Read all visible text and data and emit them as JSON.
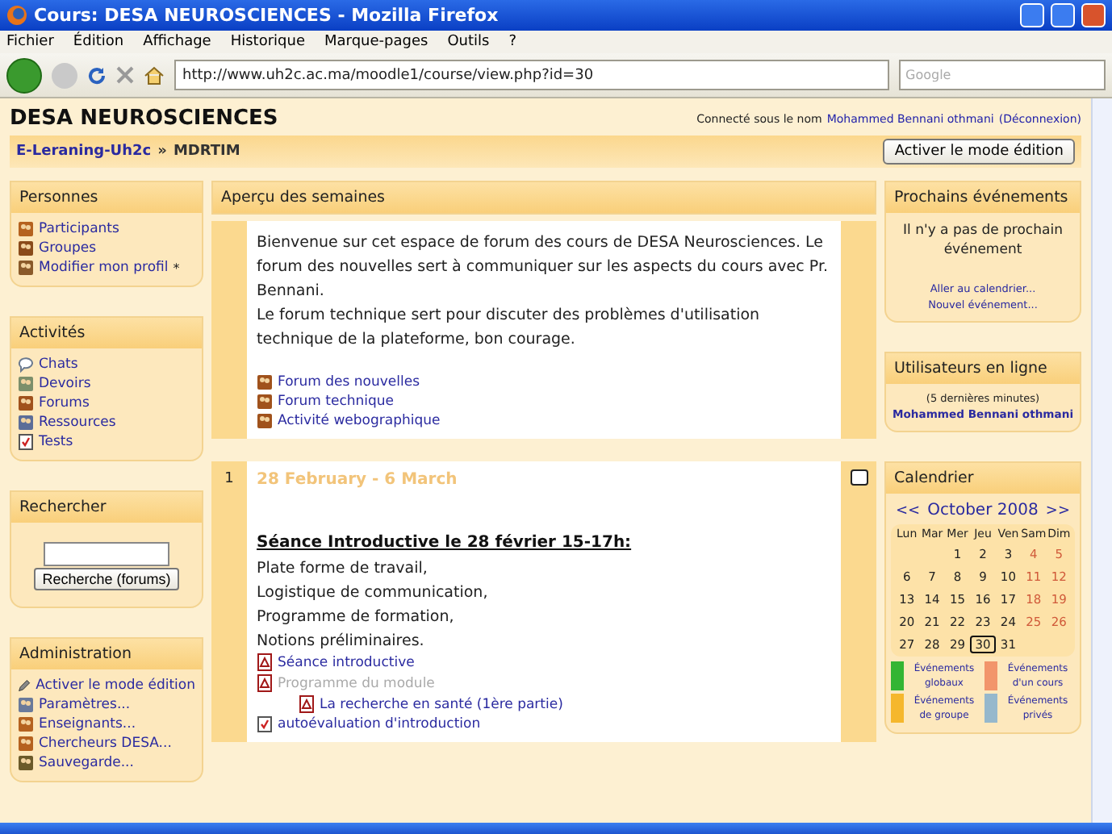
{
  "window": {
    "title": "Cours: DESA NEUROSCIENCES - Mozilla Firefox"
  },
  "menu": [
    "Fichier",
    "Édition",
    "Affichage",
    "Historique",
    "Marque-pages",
    "Outils",
    "?"
  ],
  "toolbar": {
    "url": "http://www.uh2c.ac.ma/moodle1/course/view.php?id=30",
    "search_placeholder": "Google"
  },
  "page": {
    "site_title": "DESA NEUROSCIENCES",
    "login_prefix": "Connecté sous le nom",
    "login_user": "Mohammed Bennani othmani",
    "logout": "(Déconnexion)",
    "breadcrumb": [
      "E-Leraning-Uh2c",
      "MDRTIM"
    ],
    "breadcrumb_separator": "»",
    "edit_button": "Activer le mode édition"
  },
  "left_blocks": [
    {
      "kind": "links",
      "title": "Personnes",
      "items": [
        {
          "label": "Participants",
          "kind": "people"
        },
        {
          "label": "Groupes",
          "kind": "group"
        },
        {
          "label": "Modifier mon profil",
          "kind": "profile",
          "suffix": "*"
        }
      ]
    },
    {
      "kind": "links",
      "title": "Activités",
      "items": [
        {
          "label": "Chats",
          "kind": "chat"
        },
        {
          "label": "Devoirs",
          "kind": "assignment"
        },
        {
          "label": "Forums",
          "kind": "forum"
        },
        {
          "label": "Ressources",
          "kind": "resource"
        },
        {
          "label": "Tests",
          "kind": "quiz"
        }
      ]
    },
    {
      "kind": "search",
      "title": "Rechercher",
      "button": "Recherche (forums)"
    },
    {
      "kind": "links",
      "title": "Administration",
      "items": [
        {
          "label": "Activer le mode édition",
          "kind": "edit"
        },
        {
          "label": "Paramètres...",
          "kind": "settings"
        },
        {
          "label": "Enseignants...",
          "kind": "people"
        },
        {
          "label": "Chercheurs DESA...",
          "kind": "people"
        },
        {
          "label": "Sauvegarde...",
          "kind": "backup"
        }
      ]
    }
  ],
  "center": {
    "title": "Aperçu des semaines",
    "intro": {
      "paragraphs": [
        "Bienvenue sur cet espace de forum des cours de DESA Neurosciences. Le forum des nouvelles sert à communiquer sur les aspects du cours avec Pr. Bennani.",
        "Le forum technique sert pour discuter des problèmes d'utilisation technique de la plateforme, bon courage."
      ],
      "links": [
        {
          "label": "Forum des nouvelles",
          "kind": "forum",
          "disabled": false
        },
        {
          "label": "Forum technique",
          "kind": "forum",
          "disabled": false
        },
        {
          "label": "Activité webographique",
          "kind": "forum",
          "disabled": false
        }
      ]
    },
    "weeks": [
      {
        "number": "1",
        "dates": "28 February - 6 March",
        "heading": "Séance Introductive le 28 février 15-17h:",
        "lines": [
          "Plate forme de travail,",
          "Logistique de communication,",
          "Programme de formation,",
          "Notions préliminaires."
        ],
        "links": [
          {
            "label": "Séance introductive",
            "kind": "pdf",
            "disabled": false
          },
          {
            "label": "Programme du module",
            "kind": "pdf",
            "disabled": true,
            "children": [
              {
                "label": "La recherche en santé (1ère partie)",
                "kind": "pdf",
                "disabled": false
              }
            ]
          },
          {
            "label": "autoévaluation d'introduction",
            "kind": "quiz",
            "disabled": false
          }
        ]
      }
    ]
  },
  "right_blocks": [
    {
      "kind": "events",
      "title": "Prochains événements",
      "message": "Il n'y a pas de prochain événement",
      "links": [
        "Aller au calendrier...",
        "Nouvel événement..."
      ]
    },
    {
      "kind": "online",
      "title": "Utilisateurs en ligne",
      "note": "(5 dernières minutes)",
      "users": [
        "Mohammed Bennani othmani"
      ]
    },
    {
      "kind": "calendar",
      "title": "Calendrier",
      "prev": "<<",
      "month": "October 2008",
      "next": ">>",
      "weekdays": [
        "Lun",
        "Mar",
        "Mer",
        "Jeu",
        "Ven",
        "Sam",
        "Dim"
      ],
      "weeks": [
        [
          {
            "kind": "blank"
          },
          {
            "kind": "blank"
          },
          {
            "kind": "day",
            "day": "1",
            "weekend": false,
            "today": false
          },
          {
            "kind": "day",
            "day": "2",
            "weekend": false,
            "today": false
          },
          {
            "kind": "day",
            "day": "3",
            "weekend": false,
            "today": false
          },
          {
            "kind": "day",
            "day": "4",
            "weekend": true,
            "today": false
          },
          {
            "kind": "day",
            "day": "5",
            "weekend": true,
            "today": false
          }
        ],
        [
          {
            "kind": "day",
            "day": "6",
            "weekend": false,
            "today": false
          },
          {
            "kind": "day",
            "day": "7",
            "weekend": false,
            "today": false
          },
          {
            "kind": "day",
            "day": "8",
            "weekend": false,
            "today": false
          },
          {
            "kind": "day",
            "day": "9",
            "weekend": false,
            "today": false
          },
          {
            "kind": "day",
            "day": "10",
            "weekend": false,
            "today": false
          },
          {
            "kind": "day",
            "day": "11",
            "weekend": true,
            "today": false
          },
          {
            "kind": "day",
            "day": "12",
            "weekend": true,
            "today": false
          }
        ],
        [
          {
            "kind": "day",
            "day": "13",
            "weekend": false,
            "today": false
          },
          {
            "kind": "day",
            "day": "14",
            "weekend": false,
            "today": false
          },
          {
            "kind": "day",
            "day": "15",
            "weekend": false,
            "today": false
          },
          {
            "kind": "day",
            "day": "16",
            "weekend": false,
            "today": false
          },
          {
            "kind": "day",
            "day": "17",
            "weekend": false,
            "today": false
          },
          {
            "kind": "day",
            "day": "18",
            "weekend": true,
            "today": false
          },
          {
            "kind": "day",
            "day": "19",
            "weekend": true,
            "today": false
          }
        ],
        [
          {
            "kind": "day",
            "day": "20",
            "weekend": false,
            "today": false
          },
          {
            "kind": "day",
            "day": "21",
            "weekend": false,
            "today": false
          },
          {
            "kind": "day",
            "day": "22",
            "weekend": false,
            "today": false
          },
          {
            "kind": "day",
            "day": "23",
            "weekend": false,
            "today": false
          },
          {
            "kind": "day",
            "day": "24",
            "weekend": false,
            "today": false
          },
          {
            "kind": "day",
            "day": "25",
            "weekend": true,
            "today": false
          },
          {
            "kind": "day",
            "day": "26",
            "weekend": true,
            "today": false
          }
        ],
        [
          {
            "kind": "day",
            "day": "27",
            "weekend": false,
            "today": false
          },
          {
            "kind": "day",
            "day": "28",
            "weekend": false,
            "today": false
          },
          {
            "kind": "day",
            "day": "29",
            "weekend": false,
            "today": false
          },
          {
            "kind": "day",
            "day": "30",
            "weekend": false,
            "today": true
          },
          {
            "kind": "day",
            "day": "31",
            "weekend": false,
            "today": false
          },
          {
            "kind": "blank"
          },
          {
            "kind": "blank"
          }
        ]
      ],
      "legend": [
        {
          "label": "Événements globaux",
          "color": "#33b533"
        },
        {
          "label": "Événements d'un cours",
          "color": "#f2956b"
        },
        {
          "label": "Événements de groupe",
          "color": "#f5b72c"
        },
        {
          "label": "Événements privés",
          "color": "#96b8cc"
        }
      ]
    }
  ]
}
